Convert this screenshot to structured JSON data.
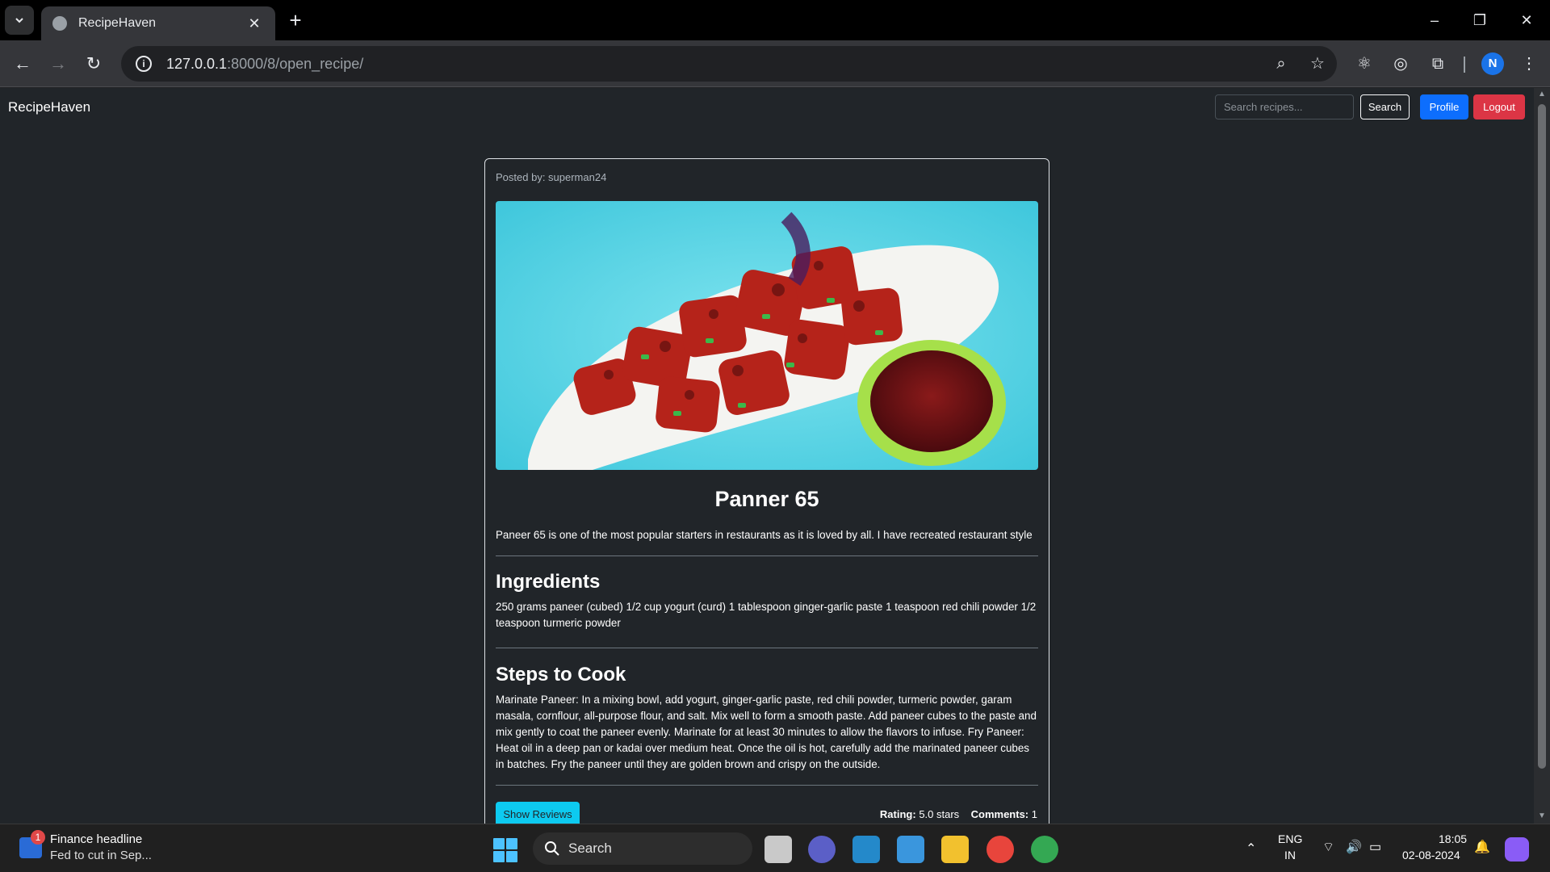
{
  "browser": {
    "tab_title": "RecipeHaven",
    "url_host": "127.0.0.1",
    "url_rest": ":8000/8/open_recipe/",
    "profile_initial": "N"
  },
  "navbar": {
    "brand": "RecipeHaven",
    "search_placeholder": "Search recipes...",
    "search_label": "Search",
    "profile_label": "Profile",
    "logout_label": "Logout"
  },
  "recipe": {
    "posted_by": "Posted by: superman24",
    "title": "Panner 65",
    "description": "Paneer 65 is one of the most popular starters in restaurants as it is loved by all. I have recreated restaurant style",
    "ingredients_heading": "Ingredients",
    "ingredients": "250 grams paneer (cubed) 1/2 cup yogurt (curd) 1 tablespoon ginger-garlic paste 1 teaspoon red chili powder 1/2 teaspoon turmeric powder",
    "steps_heading": "Steps to Cook",
    "steps": "Marinate Paneer: In a mixing bowl, add yogurt, ginger-garlic paste, red chili powder, turmeric powder, garam masala, cornflour, all-purpose flour, and salt. Mix well to form a smooth paste. Add paneer cubes to the paste and mix gently to coat the paneer evenly. Marinate for at least 30 minutes to allow the flavors to infuse. Fry Paneer: Heat oil in a deep pan or kadai over medium heat. Once the oil is hot, carefully add the marinated paneer cubes in batches. Fry the paneer until they are golden brown and crispy on the outside.",
    "show_reviews_label": "Show Reviews",
    "rating_label": "Rating:",
    "rating_value": "5.0 stars",
    "comments_label": "Comments:",
    "comments_value": "1"
  },
  "taskbar": {
    "news_badge": "1",
    "news_title": "Finance headline",
    "news_sub": "Fed to cut in Sep...",
    "search_label": "Search",
    "lang_top": "ENG",
    "lang_bottom": "IN",
    "time": "18:05",
    "date": "02-08-2024"
  },
  "colors": {
    "page_bg": "#212529",
    "primary": "#0d6efd",
    "danger": "#dc3545",
    "info": "#0dcaf0"
  }
}
